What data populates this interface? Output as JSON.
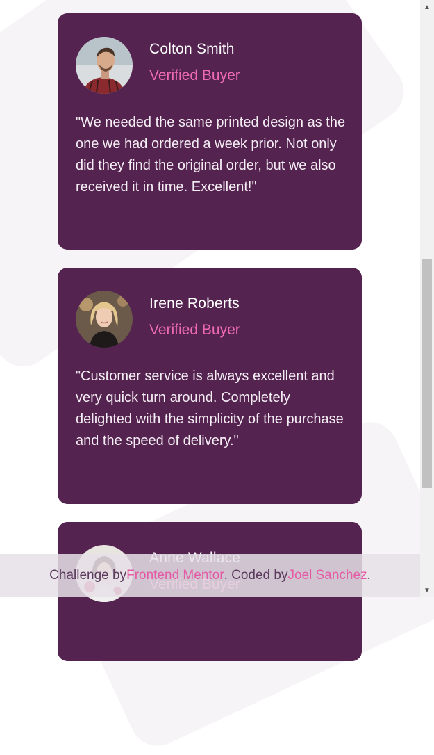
{
  "testimonials": [
    {
      "name": "Colton Smith",
      "role": "Verified Buyer",
      "quote": "\"We needed the same printed design as the one we had ordered a week prior. Not only did they find the original order, but we also received it in time. Excellent!\""
    },
    {
      "name": "Irene Roberts",
      "role": "Verified Buyer",
      "quote": "\"Customer service is always excellent and very quick turn around. Completely delighted with the simplicity of the purchase and the speed of delivery.\""
    },
    {
      "name": "Anne Wallace",
      "role": "Verified Buyer"
    }
  ],
  "footer": {
    "prefix": "Challenge by",
    "link1": "Frontend Mentor",
    "middle": ". Coded by",
    "link2": "Joel Sanchez",
    "suffix": "."
  },
  "scrollbar": {
    "up_icon": "chevron-up-icon",
    "down_icon": "chevron-down-icon"
  },
  "colors": {
    "card_bg": "#542350",
    "accent_pink": "#ee6bb2",
    "page_bg": "#ffffff"
  }
}
